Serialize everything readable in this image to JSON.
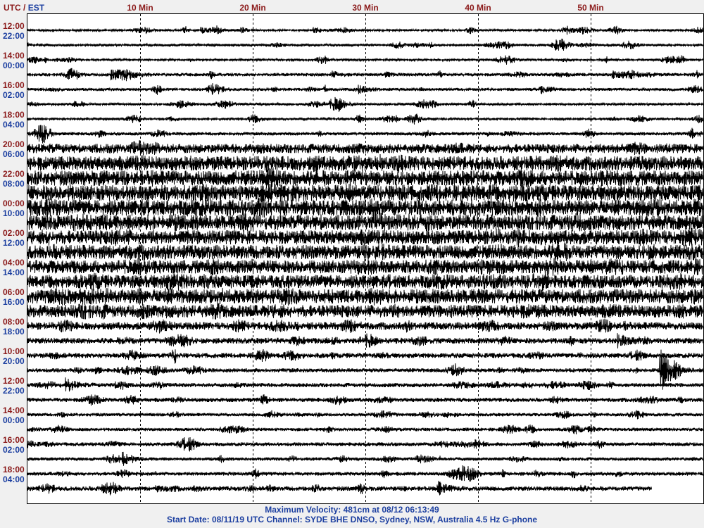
{
  "header": {
    "utc_label": "UTC",
    "separator": " / ",
    "est_label": "EST"
  },
  "footer": {
    "max_velocity": "Maximum Velocity:   481cm at 08/12 06:13:49",
    "start_info": "Start Date: 08/11/19 UTC Channel: SYDE  BHE  DNSO, Sydney, NSW, Australia  4.5 Hz G-phone"
  },
  "chart_data": {
    "type": "line",
    "title": "Helicorder seismogram",
    "xlabel": "Min",
    "xlim": [
      0,
      60
    ],
    "x_ticks": [
      {
        "value": 10,
        "label": "10 Min"
      },
      {
        "value": 20,
        "label": "20 Min"
      },
      {
        "value": 30,
        "label": "30 Min"
      },
      {
        "value": 40,
        "label": "40 Min"
      },
      {
        "value": 50,
        "label": "50 Min"
      }
    ],
    "row_labels": [
      {
        "utc": "12:00",
        "est": "22:00"
      },
      {
        "utc": "14:00",
        "est": "00:00"
      },
      {
        "utc": "16:00",
        "est": "02:00"
      },
      {
        "utc": "18:00",
        "est": "04:00"
      },
      {
        "utc": "20:00",
        "est": "06:00"
      },
      {
        "utc": "22:00",
        "est": "08:00"
      },
      {
        "utc": "00:00",
        "est": "10:00"
      },
      {
        "utc": "02:00",
        "est": "12:00"
      },
      {
        "utc": "04:00",
        "est": "14:00"
      },
      {
        "utc": "06:00",
        "est": "16:00"
      },
      {
        "utc": "08:00",
        "est": "18:00"
      },
      {
        "utc": "10:00",
        "est": "20:00"
      },
      {
        "utc": "12:00",
        "est": "22:00"
      },
      {
        "utc": "14:00",
        "est": "00:00"
      },
      {
        "utc": "16:00",
        "est": "02:00"
      },
      {
        "utc": "18:00",
        "est": "04:00"
      }
    ],
    "traces_count": 32,
    "last_trace_end_minute": 55.4,
    "relative_amplitude": [
      0.15,
      0.2,
      0.15,
      0.3,
      0.25,
      0.2,
      0.15,
      0.3,
      1.0,
      1.6,
      1.7,
      1.8,
      1.8,
      1.7,
      1.6,
      1.6,
      1.5,
      1.5,
      1.6,
      1.4,
      0.8,
      0.6,
      0.5,
      0.4,
      0.4,
      0.4,
      0.3,
      0.3,
      0.35,
      0.3,
      0.35,
      0.45
    ],
    "events": [
      {
        "trace": 0,
        "minute": 15.5,
        "amp": 4
      },
      {
        "trace": 0,
        "minute": 25.5,
        "amp": 4
      },
      {
        "trace": 0,
        "minute": 48,
        "amp": 4
      },
      {
        "trace": 3,
        "minute": 7.5,
        "amp": 6
      },
      {
        "trace": 3,
        "minute": 27,
        "amp": 4
      },
      {
        "trace": 3,
        "minute": 52,
        "amp": 5
      },
      {
        "trace": 4,
        "minute": 29.5,
        "amp": 5
      },
      {
        "trace": 8,
        "minute": 10,
        "amp": 5
      },
      {
        "trace": 21,
        "minute": 52.5,
        "amp": 8
      },
      {
        "trace": 23,
        "minute": 56.3,
        "amp": 30
      },
      {
        "trace": 24,
        "minute": 3.5,
        "amp": 8
      },
      {
        "trace": 29,
        "minute": 8.5,
        "amp": 7
      },
      {
        "trace": 31,
        "minute": 36.5,
        "amp": 8
      }
    ]
  }
}
